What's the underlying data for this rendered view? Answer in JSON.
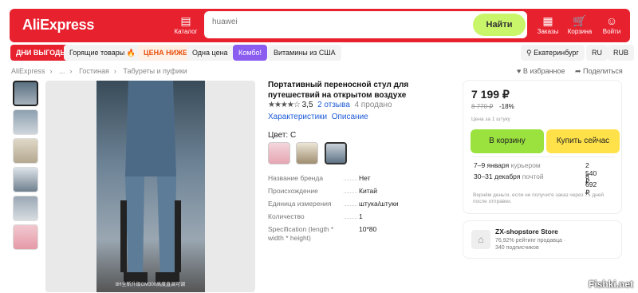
{
  "header": {
    "logo": "AliExpress",
    "catalog": "Каталог",
    "search_placeholder": "huawei",
    "search_button": "Найти",
    "orders": "Заказы",
    "cart": "Корзина",
    "login": "Войти",
    "brand_color": "#e8212f"
  },
  "nav": {
    "chips": [
      "ДНИ ВЫГОДЫ",
      "Горящие товары 🔥",
      "ЦЕНА НИЖЕ",
      "Одна цена",
      "Комбо!",
      "Витамины из США"
    ],
    "city": "Екатеринбург",
    "lang": "RU",
    "currency": "RUB"
  },
  "breadcrumbs": [
    "AliExpress",
    "...",
    "Гостиная",
    "Табуреты и пуфики"
  ],
  "actions": {
    "favorite": "В избранное",
    "share": "Поделиться"
  },
  "gallery": {
    "caption": "8H全新升级GM300高度直调可调",
    "thumb_count": 6
  },
  "product": {
    "title": "Портативный переносной стул для путешествий на открытом воздухе",
    "rating_value": "3,5",
    "rating_stars": 3.5,
    "reviews": "2 отзыва",
    "sold": "4 продано",
    "tab_specs": "Характеристики",
    "tab_desc": "Описание",
    "color_label": "Цвет: С",
    "properties": [
      {
        "k": "Название бренда",
        "v": "Нет"
      },
      {
        "k": "Происхождение",
        "v": "Китай"
      },
      {
        "k": "Единица измерения",
        "v": "штука/штуки"
      },
      {
        "k": "Количество",
        "v": "1"
      },
      {
        "k": "Specification (length * width * height)",
        "v": "10*80"
      }
    ]
  },
  "buy": {
    "price": "7 199 ₽",
    "old_price": "8 770 ₽",
    "discount": "-18%",
    "unit": "Цена за 1 штуку",
    "cart_button": "В корзину",
    "buy_button": "Купить сейчас",
    "delivery": [
      {
        "date": "7–9 января",
        "method": "курьером",
        "price": "2 540 ₽"
      },
      {
        "date": "30–31 декабря",
        "method": "почтой",
        "price": "8 692 ₽"
      }
    ],
    "refund": "Вернём деньги, если не получите заказ через 75 дней после отправки."
  },
  "store": {
    "name": "ZX-shopstore Store",
    "rating": "76,92% рейтинг продавца",
    "subscribers": "340 подписчиков"
  },
  "watermark": "Fishki.net"
}
